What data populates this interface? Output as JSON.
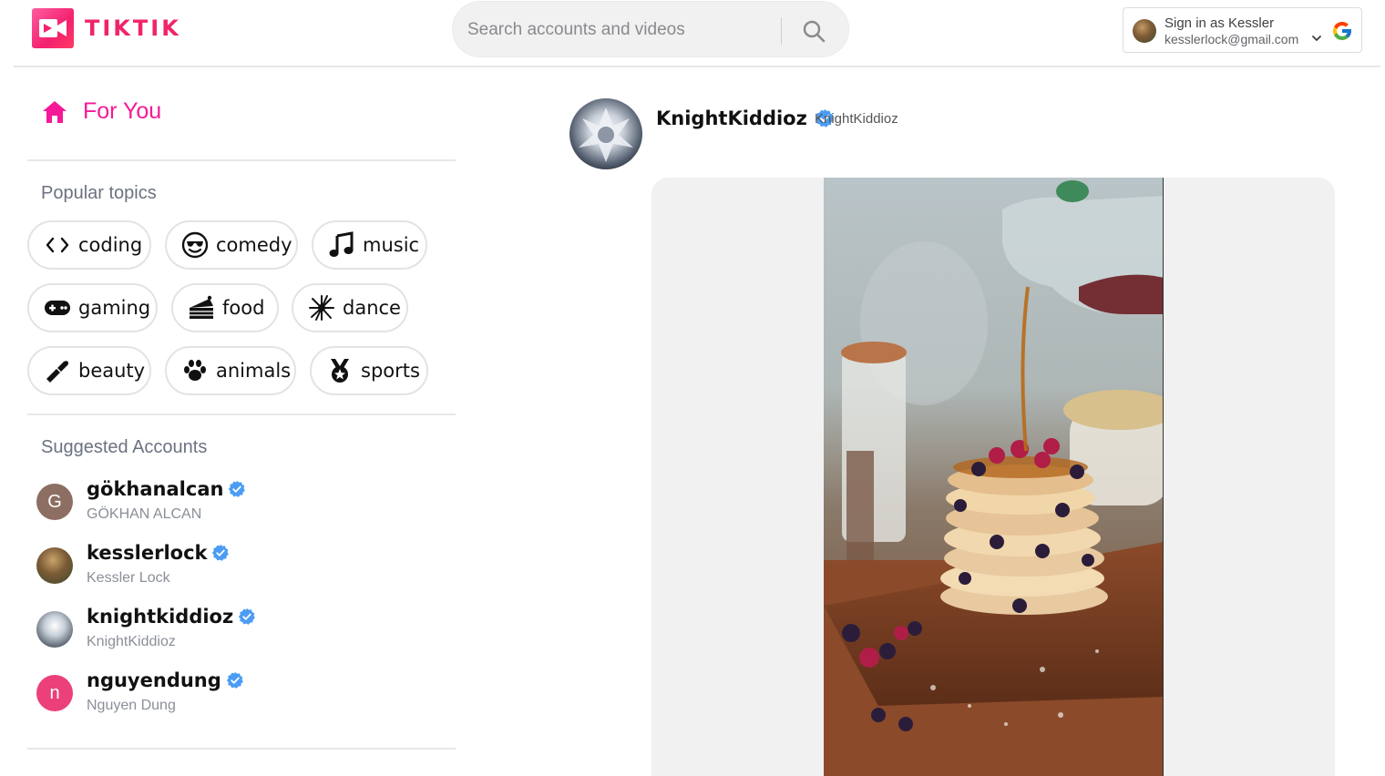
{
  "app": {
    "brand": "TIKTIK",
    "brand_color": "#f0246b",
    "accent_color": "#f51997"
  },
  "header": {
    "search": {
      "placeholder": "Search accounts and videos",
      "value": "",
      "icon": "search-icon"
    },
    "google_account": {
      "title": "Sign in as Kessler",
      "email": "kesslerlock@gmail.com",
      "icon": "google-icon"
    }
  },
  "sidebar": {
    "for_you": {
      "label": "For You",
      "icon": "home-icon"
    },
    "popular_topics_title": "Popular topics",
    "topics": [
      {
        "label": "coding",
        "icon": "code-icon"
      },
      {
        "label": "comedy",
        "icon": "smile-sunglasses-icon"
      },
      {
        "label": "music",
        "icon": "music-note-icon"
      },
      {
        "label": "gaming",
        "icon": "gamepad-icon"
      },
      {
        "label": "food",
        "icon": "cake-icon"
      },
      {
        "label": "dance",
        "icon": "dance-burst-icon"
      },
      {
        "label": "beauty",
        "icon": "lipstick-icon"
      },
      {
        "label": "animals",
        "icon": "paw-icon"
      },
      {
        "label": "sports",
        "icon": "medal-icon"
      }
    ],
    "suggested_title": "Suggested Accounts",
    "accounts": [
      {
        "username": "gökhanalcan",
        "name": "GÖKHAN ALCAN",
        "initial": "G",
        "avatar_color": "#8d6e63",
        "verified": true
      },
      {
        "username": "kesslerlock",
        "name": "Kessler Lock",
        "initial": "",
        "avatar_color": "#6b5a3a",
        "verified": true
      },
      {
        "username": "knightkiddioz",
        "name": "KnightKiddioz",
        "initial": "",
        "avatar_color": "#c7cfd8",
        "verified": true
      },
      {
        "username": "nguyendung",
        "name": "Nguyen Dung",
        "initial": "n",
        "avatar_color": "#ec407a",
        "verified": true
      }
    ]
  },
  "post": {
    "username": "KnightKiddioz",
    "handle": "KnightKiddioz",
    "verified": true,
    "verified_color": "#4b9cf5"
  }
}
